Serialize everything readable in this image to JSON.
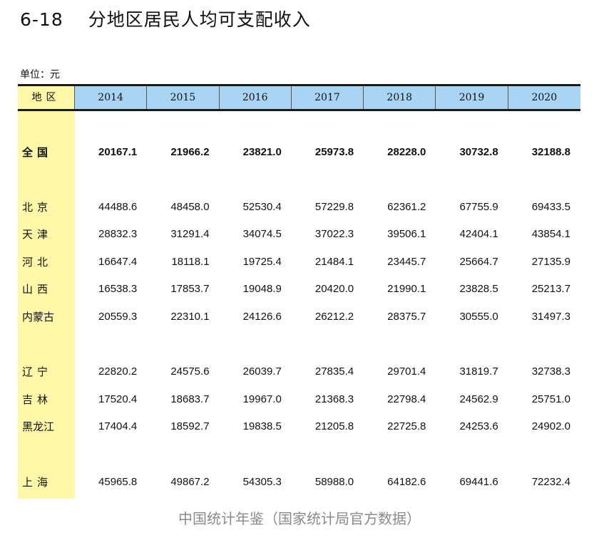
{
  "title": {
    "number": "6-18",
    "text": "分地区居民人均可支配收入"
  },
  "unit": "单位：元",
  "table": {
    "region_header": "地区",
    "years": [
      "2014",
      "2015",
      "2016",
      "2017",
      "2018",
      "2019",
      "2020"
    ],
    "rows": [
      {
        "name": "全国",
        "values": [
          "20167.1",
          "21966.2",
          "23821.0",
          "25973.8",
          "28228.0",
          "30732.8",
          "32188.8"
        ]
      },
      {
        "name": "北京",
        "values": [
          "44488.6",
          "48458.0",
          "52530.4",
          "57229.8",
          "62361.2",
          "67755.9",
          "69433.5"
        ]
      },
      {
        "name": "天津",
        "values": [
          "28832.3",
          "31291.4",
          "34074.5",
          "37022.3",
          "39506.1",
          "42404.1",
          "43854.1"
        ]
      },
      {
        "name": "河北",
        "values": [
          "16647.4",
          "18118.1",
          "19725.4",
          "21484.1",
          "23445.7",
          "25664.7",
          "27135.9"
        ]
      },
      {
        "name": "山西",
        "values": [
          "16538.3",
          "17853.7",
          "19048.9",
          "20420.0",
          "21990.1",
          "23828.5",
          "25213.7"
        ]
      },
      {
        "name": "内蒙古",
        "values": [
          "20559.3",
          "22310.1",
          "24126.6",
          "26212.2",
          "28375.7",
          "30555.0",
          "31497.3"
        ]
      },
      {
        "name": "辽宁",
        "values": [
          "22820.2",
          "24575.6",
          "26039.7",
          "27835.4",
          "29701.4",
          "31819.7",
          "32738.3"
        ]
      },
      {
        "name": "吉林",
        "values": [
          "17520.4",
          "18683.7",
          "19967.0",
          "21368.3",
          "22798.4",
          "24562.9",
          "25751.0"
        ]
      },
      {
        "name": "黑龙江",
        "values": [
          "17404.4",
          "18592.7",
          "19838.5",
          "21205.8",
          "22725.8",
          "24253.6",
          "24902.0"
        ]
      },
      {
        "name": "上海",
        "values": [
          "45965.8",
          "49867.2",
          "54305.3",
          "58988.0",
          "64182.6",
          "69441.6",
          "72232.4"
        ]
      }
    ]
  },
  "source": "中国统计年鉴（国家统计局官方数据）",
  "colors": {
    "region_column": "#fff8a8",
    "year_header": "#a9d4f4"
  }
}
